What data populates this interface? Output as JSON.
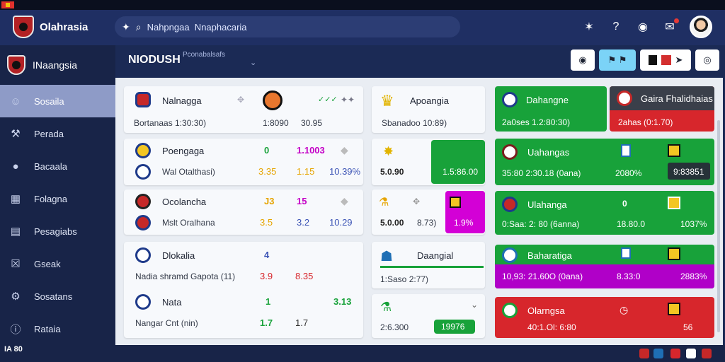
{
  "app": {
    "title": "Olahrasia"
  },
  "search": {
    "value": "Nahpngaa  Nnaphacaria"
  },
  "sidebar": {
    "header": "INaangsia",
    "items": [
      {
        "label": "Sosaila",
        "icon": "user-icon",
        "glyph": "☺",
        "active": true
      },
      {
        "label": "Perada",
        "icon": "wrench-icon",
        "glyph": "⚒",
        "active": false
      },
      {
        "label": "Bacaala",
        "icon": "person-icon",
        "glyph": "●",
        "active": false
      },
      {
        "label": "Folagna",
        "icon": "calendar-icon",
        "glyph": "▦",
        "active": false
      },
      {
        "label": "Pesagiabs",
        "icon": "document-icon",
        "glyph": "▤",
        "active": false
      },
      {
        "label": "Gseak",
        "icon": "grid-icon",
        "glyph": "☒",
        "active": false
      },
      {
        "label": "Sosatans",
        "icon": "settings-icon",
        "glyph": "⚙",
        "active": false
      },
      {
        "label": "Rataia",
        "icon": "info-icon",
        "glyph": "ⓘ",
        "active": false
      }
    ],
    "footer": "IA 80"
  },
  "subheader": {
    "title": "NIODUSH",
    "subtitle": "Pconabalsafs"
  },
  "col1": {
    "card1": {
      "team": "Nalnagga",
      "line": "Bortanaas  1:30:30)",
      "v1": "1:8090",
      "v2": "30.95"
    },
    "card2": {
      "row1": {
        "team": "Poengaga",
        "a": "0",
        "b": "1.1003"
      },
      "row2": {
        "team": "Wal  Otalthasi)",
        "a": "3.35",
        "b": "1.15",
        "c": "10.39%"
      }
    },
    "card3": {
      "row1": {
        "team": "Ocolancha",
        "a": "J3",
        "b": "15"
      },
      "row2": {
        "team": "Mslt  Oralhana",
        "a": "3.5",
        "b": "3.2",
        "c": "10.29"
      }
    },
    "card4": {
      "row1": {
        "team": "Dlokalia",
        "a": "4"
      },
      "row2": {
        "team": "Nadia  shramd  Gapota  (11)",
        "a": "3.9",
        "b": "8.35"
      },
      "row3": {
        "team": "Nata",
        "a": "1",
        "b": "3.13"
      },
      "row4": {
        "team": "Nangar  Cnt  (nin)",
        "a": "1.7",
        "b": "1.7"
      }
    }
  },
  "col2": {
    "card1": {
      "team": "Apoangia",
      "line": "Sbanadoo  10:89)"
    },
    "card2": {
      "left": "5.0.90",
      "right": "1.5:86.00"
    },
    "card3": {
      "left": "5.0.00",
      "mid": "8.73)",
      "right": "1.9%"
    },
    "card4": {
      "team": "Daangial",
      "line": "1:Saso  2:77)"
    },
    "card5": {
      "left": "2:6.300",
      "right": "19976"
    }
  },
  "col3": {
    "top_green": {
      "team": "Dahangne",
      "line": "2a0ses  1.2:80:30)"
    },
    "top_red": {
      "team": "Gaira  Fhalidhaias",
      "line": "2ahas  (0:1.70)"
    },
    "g2": {
      "team": "Uahangas",
      "line": "35:80  2:30.18  (0ana)",
      "v1": "2080%",
      "v2": "9:83851"
    },
    "g3": {
      "team": "Ulahanga",
      "a": "0",
      "line": "0:Saa:  2:  80  (6anna)",
      "v1": "18.80.0",
      "v2": "1037%"
    },
    "g4": {
      "team": "Baharatiga",
      "line": "10,93:  21.60O  (0ana)",
      "v1": "8.33:0",
      "v2": "2883%"
    },
    "r5": {
      "team": "Olarngsa",
      "line": "40:1.Ol:  6:80",
      "v": "56"
    }
  },
  "colors": {
    "green": "#18a23a",
    "red": "#d7262c",
    "magenta": "#c400c6",
    "navy": "#1f2f63"
  }
}
